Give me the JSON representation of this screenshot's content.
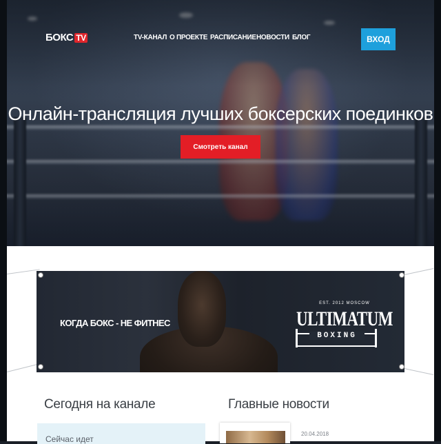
{
  "header": {
    "logo_text": "БОКС",
    "logo_badge": "TV",
    "nav": [
      {
        "label": "TV-КАНАЛ"
      },
      {
        "label": "О ПРОЕКТЕ"
      },
      {
        "label": "РАСПИСАНИЕ"
      },
      {
        "label": "НОВОСТИ"
      },
      {
        "label": "БЛОГ"
      }
    ],
    "login_label": "ВХОД"
  },
  "hero": {
    "headline": "Онлайн-трансляция лучших боксерских поединков",
    "cta_label": "Смотреть канал"
  },
  "banner": {
    "slogan": "КОГДА БОКС - НЕ ФИТНЕС",
    "brand_est": "EST. 2012 MOSCOW",
    "brand_word": "ULTIMATUM",
    "brand_sub": "BOXING"
  },
  "schedule": {
    "title": "Сегодня на канале",
    "now_label": "Сейчас идет"
  },
  "news": {
    "title": "Главные новости",
    "items": [
      {
        "date": "20.04.2018"
      }
    ]
  },
  "colors": {
    "accent_red": "#e31e26",
    "accent_blue": "#1ea0dc",
    "now_box_bg": "#e4f2f8"
  }
}
